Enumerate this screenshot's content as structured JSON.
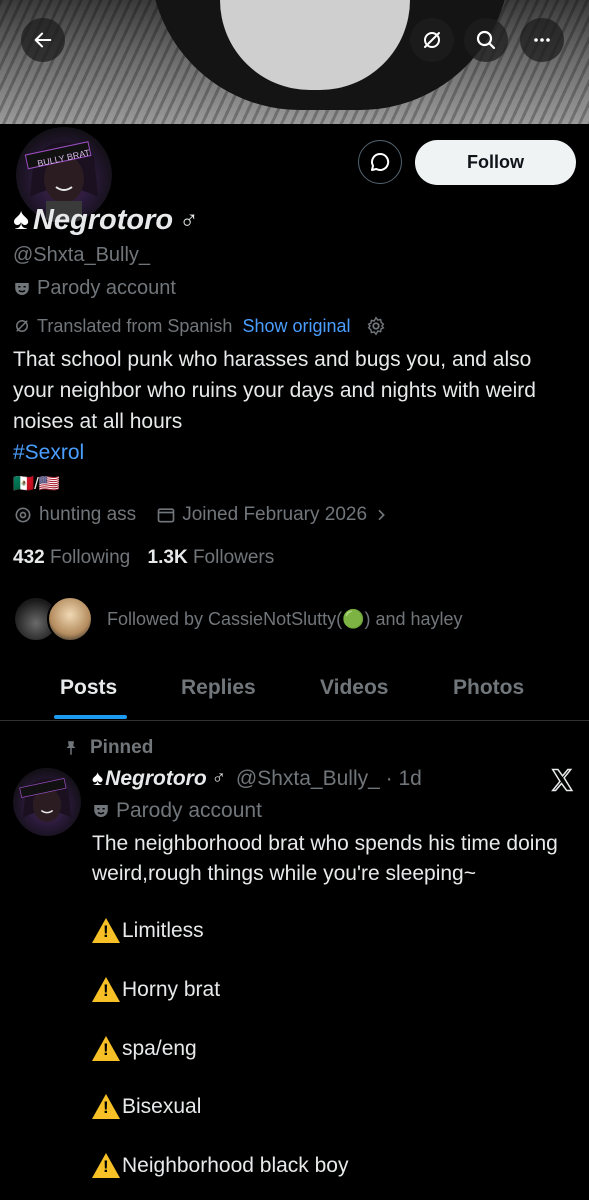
{
  "header": {
    "back_icon": "arrow-left-icon",
    "translate_icon": "no-translate-icon",
    "search_icon": "search-icon",
    "more_icon": "more-dots-icon"
  },
  "profile": {
    "name": "Negrotoro",
    "name_prefix": "♠",
    "name_suffix": "♂",
    "handle": "@Shxta_Bully_",
    "parody_label": "Parody account",
    "avatar_text": "BULLY BRAT",
    "follow_label": "Follow",
    "translated_label": "Translated from Spanish",
    "show_original_label": "Show original",
    "bio_text": "That school punk who harasses and bugs you, and also your neighbor who ruins your days and nights with weird noises at all hours",
    "bio_hashtag": "#Sexrol",
    "bio_flags": "🇲🇽/🇺🇸",
    "location": "hunting ass",
    "joined": "Joined February 2026",
    "following_count": "432",
    "following_label": "Following",
    "followers_count": "1.3K",
    "followers_label": "Followers",
    "followed_by_text": "Followed by CassieNotSlutty(🟢) and hayley"
  },
  "tabs": [
    {
      "label": "Posts"
    },
    {
      "label": "Replies"
    },
    {
      "label": "Videos"
    },
    {
      "label": "Photos"
    }
  ],
  "post": {
    "pinned_label": "Pinned",
    "author_name": "Negrotoro",
    "handle_time": "@Shxta_Bully_ · 1d",
    "parody_label": "Parody account",
    "text": "The neighborhood brat who spends his time doing weird,rough things while you're sleeping~",
    "bullets": [
      "Limitless",
      "Horny brat",
      "spa/eng",
      "Bisexual",
      "Neighborhood black boy"
    ],
    "x_logo": "X"
  },
  "colors": {
    "accent": "#1d9bf0",
    "link": "#4a9eff",
    "muted": "#71767b",
    "text": "#e7e9ea",
    "warning": "#f6c026"
  }
}
